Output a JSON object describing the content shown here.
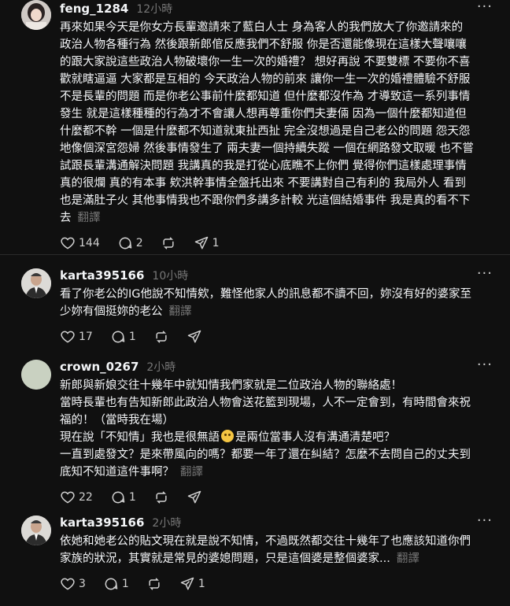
{
  "translate_label": "翻譯",
  "posts": [
    {
      "username": "feng_1284",
      "time": "12小時",
      "lines": [
        "再來如果今天是你女方長輩邀請來了藍白人士 身為客人的我們放大了你邀請來的",
        "政治人物各種行為 然後跟新郎倌反應我們不舒服 你是否還能像現在這樣大聲嚷嚷",
        "的跟大家說這些政治人物破壞你一生一次的婚禮？ 想好再說 不要雙標 不要你不喜",
        "歡就瞎逼逼 大家都是互相的 今天政治人物的前來 讓你一生一次的婚禮體驗不舒服",
        "不是長輩的問題 而是你老公事前什麼都知道 但什麼都沒作為 才導致這一系列事情",
        "發生 就是這樣種種的行為才不會讓人想再尊重你們夫妻倆 因為一個什麼都知道但",
        "什麼都不幹 一個是什麼都不知道就東扯西扯 完全沒想過是自己老公的問題 怨天怨",
        "地像個深宮怨婦 然後事情發生了 兩夫妻一個持續失蹤 一個在網路發文取暖 也不嘗",
        "試跟長輩溝通解決問題 我講真的我是打從心底瞧不上你們 覺得你們這樣處理事情",
        "真的很爛 真的有本事 欸洪幹事情全盤托出來 不要講對自己有利的 我局外人 看到",
        "也是滿肚子火 其他事情我也不跟你們多講多計較 光這個結婚事件 我是真的看不下",
        "去"
      ],
      "likes": "144",
      "comments": "2",
      "reposts": "",
      "shares": "1"
    },
    {
      "username": "karta395166",
      "time": "10小時",
      "lines": [
        "看了你老公的IG他說不知情欸，難怪他家人的訊息都不讀不回，妳沒有好的婆家至",
        "少妳有個挺妳的老公"
      ],
      "likes": "17",
      "comments": "1",
      "reposts": "",
      "shares": ""
    },
    {
      "username": "crown_0267",
      "time": "2小時",
      "lines": [
        "新郎與新娘交往十幾年中就知情我們家就是二位政治人物的聯絡處！",
        "當時長輩也有告知新郎此政治人物會送花籃到現場，人不一定會到，有時間會來祝",
        "福的！（當時我在場）",
        "現在說「不知情」我也是很無語",
        "一直到處發文？是來帶風向的嗎？都要一年了還在糾結？怎麼不去問自己的丈夫到",
        "底知不知道這件事啊？"
      ],
      "line4_tail": "是兩位當事人沒有溝通清楚吧？",
      "likes": "22",
      "comments": "1",
      "reposts": "",
      "shares": ""
    },
    {
      "username": "karta395166",
      "time": "2小時",
      "lines": [
        "依她和她老公的貼文現在就是說不知情，不過既然都交往十幾年了也應該知道你們",
        "家族的狀況，其實就是常見的婆媳問題，只是這個婆是整個婆家..."
      ],
      "likes": "3",
      "comments": "1",
      "reposts": "",
      "shares": "1"
    }
  ],
  "icons": {
    "like": "heart-icon",
    "comment": "comment-icon",
    "repost": "repost-icon",
    "share": "share-icon",
    "more": "more-icon"
  },
  "colors": {
    "background": "#101010",
    "text": "#f3f5f7",
    "muted": "#777777",
    "divider": "#2b2b2b"
  }
}
